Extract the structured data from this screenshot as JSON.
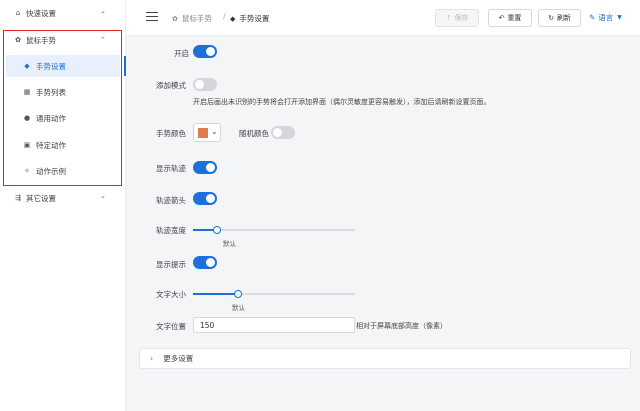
{
  "sidebar": {
    "quick_settings": {
      "label": "快速设置",
      "icon": "home-icon"
    },
    "mouse_gesture": {
      "label": "鼠标手势",
      "icon": "gear-icon"
    },
    "sub_items": [
      {
        "label": "手势设置",
        "icon": "gesture-icon",
        "active": true
      },
      {
        "label": "手势列表",
        "icon": "grid-icon"
      },
      {
        "label": "通用动作",
        "icon": "globe-icon"
      },
      {
        "label": "特定动作",
        "icon": "briefcase-icon"
      },
      {
        "label": "动作示例",
        "icon": "sparkle-icon"
      }
    ],
    "other_settings": {
      "label": "其它设置",
      "icon": "sliders-icon"
    }
  },
  "header": {
    "breadcrumb": [
      "鼠标手势",
      "手势设置"
    ],
    "save_label": "保存",
    "reset_label": "重置",
    "refresh_label": "刷新",
    "language_label": "语言"
  },
  "form": {
    "enable": {
      "label": "开启",
      "value": true
    },
    "add_mode": {
      "label": "添加模式",
      "value": false,
      "note": "开启后画出未识别的手势将会打开添加界面（偶尔灵敏度更容易触发），添加后请刷新设置页面。"
    },
    "gesture_color": {
      "label": "手势颜色",
      "value": "#e07b4b"
    },
    "random_color": {
      "label": "随机颜色",
      "value": false
    },
    "show_trail": {
      "label": "显示轨迹",
      "value": true
    },
    "trail_arrow": {
      "label": "轨迹箭头",
      "value": true
    },
    "trail_width": {
      "label": "轨迹宽度",
      "caption": "默认",
      "value": 0.15
    },
    "show_hint": {
      "label": "显示提示",
      "value": true
    },
    "text_size": {
      "label": "文字大小",
      "caption": "默认",
      "value": 0.28
    },
    "text_position": {
      "label": "文字位置",
      "value": "150",
      "suffix": "相对于屏幕底部高度（像素）"
    },
    "more_settings": {
      "label": "更多设置"
    }
  },
  "colors": {
    "accent": "#1e6fd9",
    "highlight_box": "#e02424"
  }
}
